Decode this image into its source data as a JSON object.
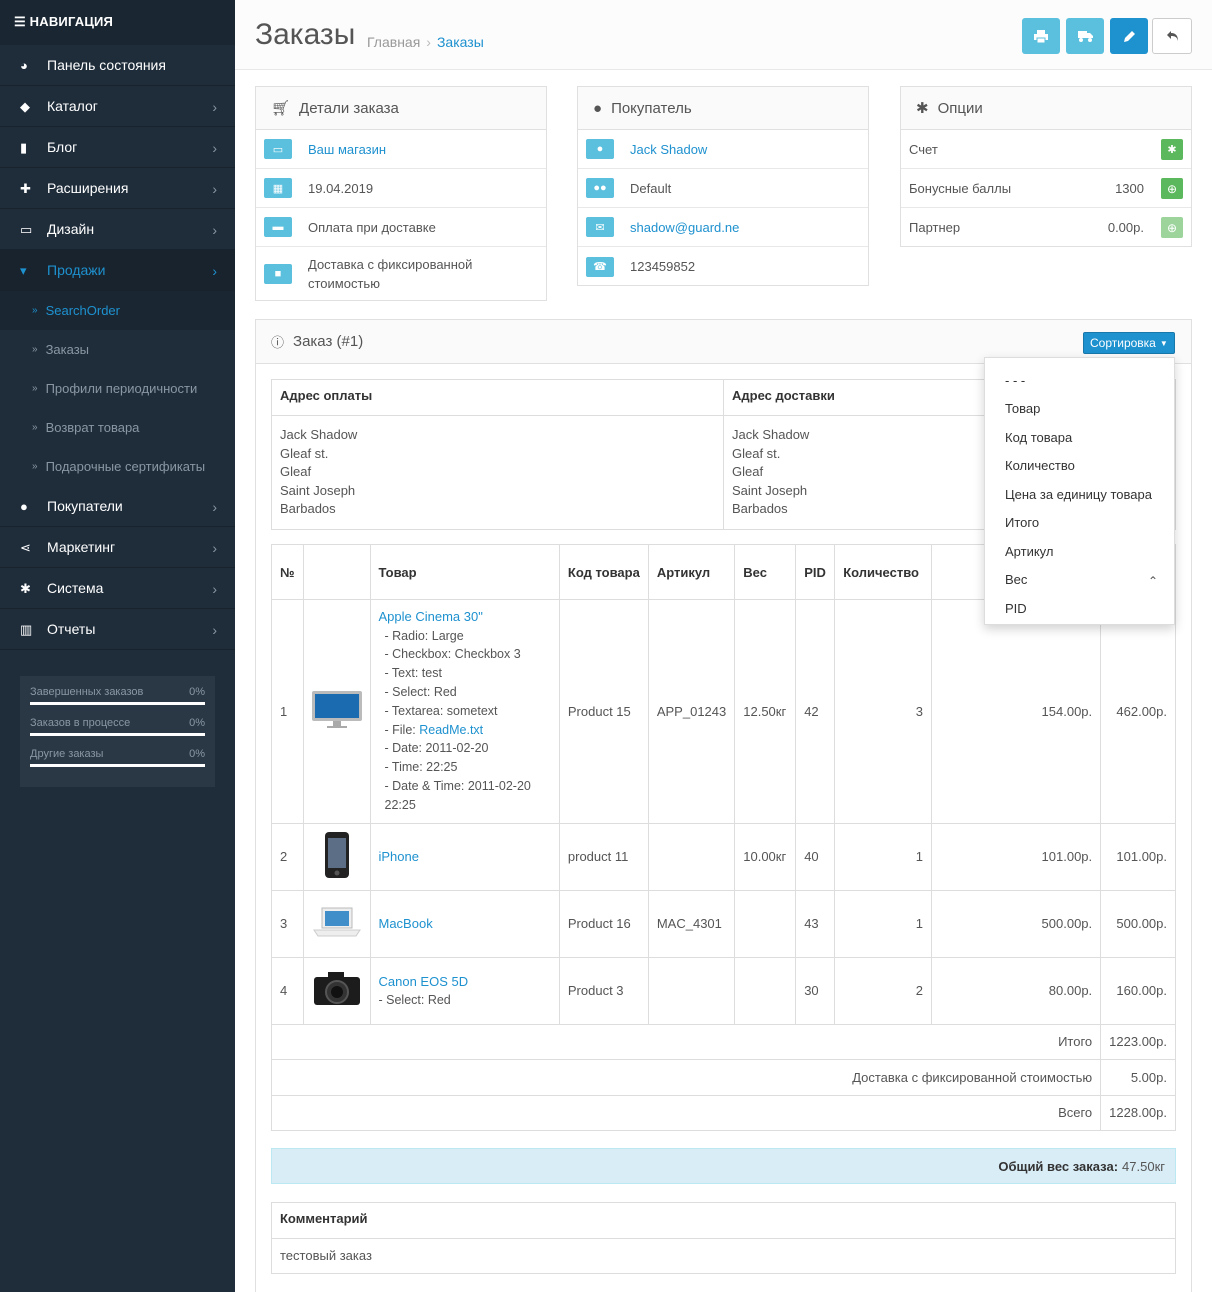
{
  "sidebar": {
    "header": "НАВИГАЦИЯ",
    "items": [
      {
        "label": "Панель состояния",
        "icon": "dashboard-icon"
      },
      {
        "label": "Каталог",
        "icon": "tag-icon"
      },
      {
        "label": "Блог",
        "icon": "book-icon"
      },
      {
        "label": "Расширения",
        "icon": "puzzle-icon"
      },
      {
        "label": "Дизайн",
        "icon": "monitor-icon"
      },
      {
        "label": "Продажи",
        "icon": "cart-icon"
      }
    ],
    "subitems": [
      "SearchOrder",
      "Заказы",
      "Профили периодичности",
      "Возврат товара",
      "Подарочные сертификаты"
    ],
    "items2": [
      {
        "label": "Покупатели",
        "icon": "user-icon"
      },
      {
        "label": "Маркетинг",
        "icon": "share-icon"
      },
      {
        "label": "Система",
        "icon": "gear-icon"
      },
      {
        "label": "Отчеты",
        "icon": "bar-chart-icon"
      }
    ],
    "stats": [
      {
        "label": "Завершенных заказов",
        "value": "0%"
      },
      {
        "label": "Заказов в процессе",
        "value": "0%"
      },
      {
        "label": "Другие заказы",
        "value": "0%"
      }
    ]
  },
  "header": {
    "title": "Заказы",
    "crumb_home": "Главная",
    "crumb_current": "Заказы"
  },
  "order_details": {
    "title": "Детали заказа",
    "store": "Ваш магазин",
    "date": "19.04.2019",
    "payment": "Оплата при доставке",
    "shipping": "Доставка с фиксированной стоимостью"
  },
  "customer": {
    "title": "Покупатель",
    "name": "Jack Shadow",
    "group": "Default",
    "email": "shadow@guard.ne",
    "phone": "123459852"
  },
  "options": {
    "title": "Опции",
    "invoice": "Счет",
    "reward_label": "Бонусные баллы",
    "reward_value": "1300",
    "affiliate_label": "Партнер",
    "affiliate_value": "0.00р."
  },
  "order": {
    "title": "Заказ (#1)",
    "sort_label": "Сортировка",
    "payment_addr_head": "Адрес оплаты",
    "shipping_addr_head": "Адрес доставки",
    "payment_addr": [
      "Jack Shadow",
      "Gleaf st.",
      "Gleaf",
      "Saint Joseph",
      "Barbados"
    ],
    "shipping_addr": [
      "Jack Shadow",
      "Gleaf st.",
      "Gleaf",
      "Saint Joseph",
      "Barbados"
    ],
    "columns": {
      "num": "№",
      "product": "Товар",
      "model": "Код товара",
      "sku": "Артикул",
      "weight": "Вес",
      "pid": "PID",
      "qty": "Количество"
    },
    "rows": [
      {
        "n": "1",
        "name": "Apple Cinema 30\"",
        "options": [
          "- Radio: Large",
          "- Checkbox: Checkbox 3",
          "- Text: test",
          "- Select: Red",
          "- Textarea: sometext"
        ],
        "file_prefix": "- File: ",
        "file": "ReadMe.txt",
        "options2": [
          "- Date: 2011-02-20",
          "- Time: 22:25",
          "- Date & Time: 2011-02-20 22:25"
        ],
        "model": "Product 15",
        "sku": "APP_01243",
        "weight": "12.50кг",
        "pid": "42",
        "qty": "3",
        "price": "154.00р.",
        "total": "462.00р."
      },
      {
        "n": "2",
        "name": "iPhone",
        "model": "product 11",
        "sku": "",
        "weight": "10.00кг",
        "pid": "40",
        "qty": "1",
        "price": "101.00р.",
        "total": "101.00р."
      },
      {
        "n": "3",
        "name": "MacBook",
        "model": "Product 16",
        "sku": "MAC_4301",
        "weight": "",
        "pid": "43",
        "qty": "1",
        "price": "500.00р.",
        "total": "500.00р."
      },
      {
        "n": "4",
        "name": "Canon EOS 5D",
        "opt": "- Select: Red",
        "model": "Product 3",
        "sku": "",
        "weight": "",
        "pid": "30",
        "qty": "2",
        "price": "80.00р.",
        "total": "160.00р."
      }
    ],
    "totals": [
      {
        "label": "Итого",
        "value": "1223.00р."
      },
      {
        "label": "Доставка с фиксированной стоимостью",
        "value": "5.00р."
      },
      {
        "label": "Всего",
        "value": "1228.00р."
      }
    ],
    "weight_label": "Общий вес заказа:",
    "weight_value": "47.50кг",
    "comment_head": "Комментарий",
    "comment": "тестовый заказ"
  },
  "dropdown": [
    "- - -",
    "Товар",
    "Код товара",
    "Количество",
    "Цена за единицу товара",
    "Итого",
    "Артикул",
    "Вес",
    "PID"
  ],
  "colors": {
    "accent": "#1e91cf",
    "info": "#5bc0de",
    "success": "#5cb85c",
    "sidebar": "#1f2d3b"
  }
}
